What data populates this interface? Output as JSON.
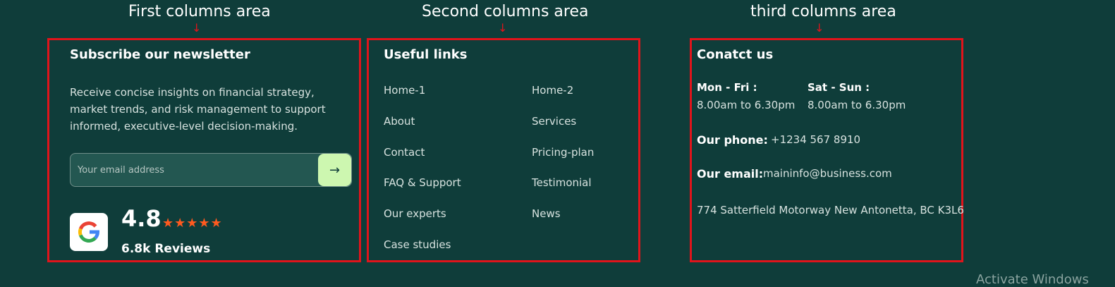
{
  "annotations": {
    "first": "First columns area",
    "second": "Second columns area",
    "third": "third columns area",
    "arrow": "↓"
  },
  "column1": {
    "title": "Subscribe our newsletter",
    "text": "Receive concise insights on financial strategy, market trends, and risk management to support informed, executive-level decision-making.",
    "email_placeholder": "Your email address",
    "submit_icon": "→",
    "rating": "4.8",
    "stars": "★★★★★",
    "reviews": "6.8k Reviews"
  },
  "column2": {
    "title": "Useful links",
    "links_left": [
      "Home-1",
      "About",
      "Contact",
      "FAQ & Support",
      "Our experts",
      "Case studies"
    ],
    "links_right": [
      "Home-2",
      "Services",
      "Pricing-plan",
      "Testimonial",
      "News"
    ]
  },
  "column3": {
    "title": "Conatct us",
    "weekdays_label": "Mon - Fri :",
    "weekdays_hours": "8.00am to 6.30pm",
    "weekend_label": "Sat - Sun :",
    "weekend_hours": "8.00am to 6.30pm",
    "phone_label": "Our phone:",
    "phone_value": "+1234 567 8910",
    "email_label": "Our email:",
    "email_value": "maininfo@business.com",
    "address": "774 Satterfield Motorway New Antonetta, BC K3L6"
  },
  "watermark": "Activate Windows",
  "colors": {
    "background": "#0f3d3a",
    "annotation_red": "#e0141b",
    "accent_green": "#cdf7b0",
    "star_orange": "#ff5a1f"
  }
}
